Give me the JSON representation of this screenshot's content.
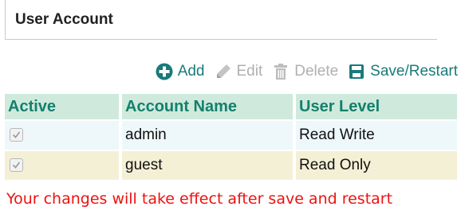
{
  "panel": {
    "title": "User Account"
  },
  "toolbar": {
    "add": {
      "label": "Add",
      "icon": "plus-circle-icon",
      "enabled": true
    },
    "edit": {
      "label": "Edit",
      "icon": "pencil-icon",
      "enabled": false
    },
    "delete": {
      "label": "Delete",
      "icon": "trash-icon",
      "enabled": false
    },
    "save": {
      "label": "Save/Restart",
      "icon": "floppy-disk-icon",
      "enabled": true
    }
  },
  "table": {
    "columns": [
      "Active",
      "Account Name",
      "User Level"
    ],
    "rows": [
      {
        "active": true,
        "account_name": "admin",
        "user_level": "Read Write"
      },
      {
        "active": true,
        "account_name": "guest",
        "user_level": "Read Only"
      }
    ]
  },
  "notice": "Your changes will take effect after save and restart",
  "colors": {
    "accent": "#1a7a7a",
    "header_bg": "#cfeadc",
    "header_text": "#13806e",
    "row_1_bg": "#eef8fb",
    "row_2_bg": "#f4f0d6",
    "notice_text": "#ee1111",
    "disabled_text": "#b0b0b0"
  }
}
